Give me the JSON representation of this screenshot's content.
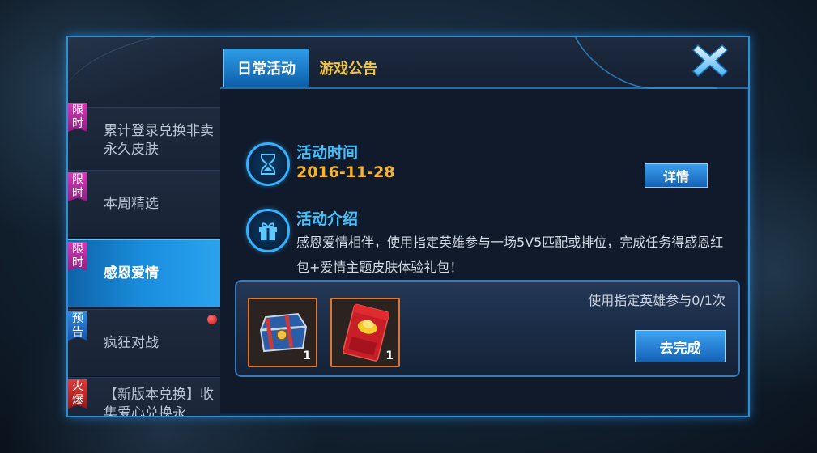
{
  "tabs": {
    "active": "日常活动",
    "other": "游戏公告"
  },
  "sidebar": {
    "items": [
      {
        "tag": "限时",
        "label": "累计登录兑换非卖永久皮肤",
        "tag_color": "pink"
      },
      {
        "tag": "限时",
        "label": "本周精选",
        "tag_color": "pink"
      },
      {
        "tag": "限时",
        "label": "感恩爱情",
        "tag_color": "pink",
        "active": true
      },
      {
        "tag": "预告",
        "label": "疯狂对战",
        "tag_color": "blue",
        "has_red_dot": true
      },
      {
        "tag": "火爆",
        "label": "【新版本兑换】收集爱心兑换永",
        "tag_color": "red"
      }
    ]
  },
  "activity": {
    "time_title": "活动时间",
    "date": "2016-11-28",
    "detail_button": "详情",
    "intro_title": "活动介绍",
    "description": "感恩爱情相伴，使用指定英雄参与一场5V5匹配或排位，完成任务得感恩红包+爱情主题皮肤体验礼包！"
  },
  "task": {
    "progress_text": "使用指定英雄参与0/1次",
    "go_button": "去完成",
    "rewards": [
      {
        "name": "treasure-chest",
        "count": "1"
      },
      {
        "name": "red-envelope",
        "count": "1"
      }
    ]
  },
  "colors": {
    "accent_blue": "#3fc2ff",
    "date_gold": "#f3b431",
    "tab_gold": "#f0c64a",
    "tag_pink": "#d93ab8",
    "tag_blue": "#2f8ae0",
    "tag_red": "#e23a3a"
  },
  "icons": {
    "time": "hourglass-icon",
    "intro": "gift-icon",
    "close": "close-x-icon"
  }
}
